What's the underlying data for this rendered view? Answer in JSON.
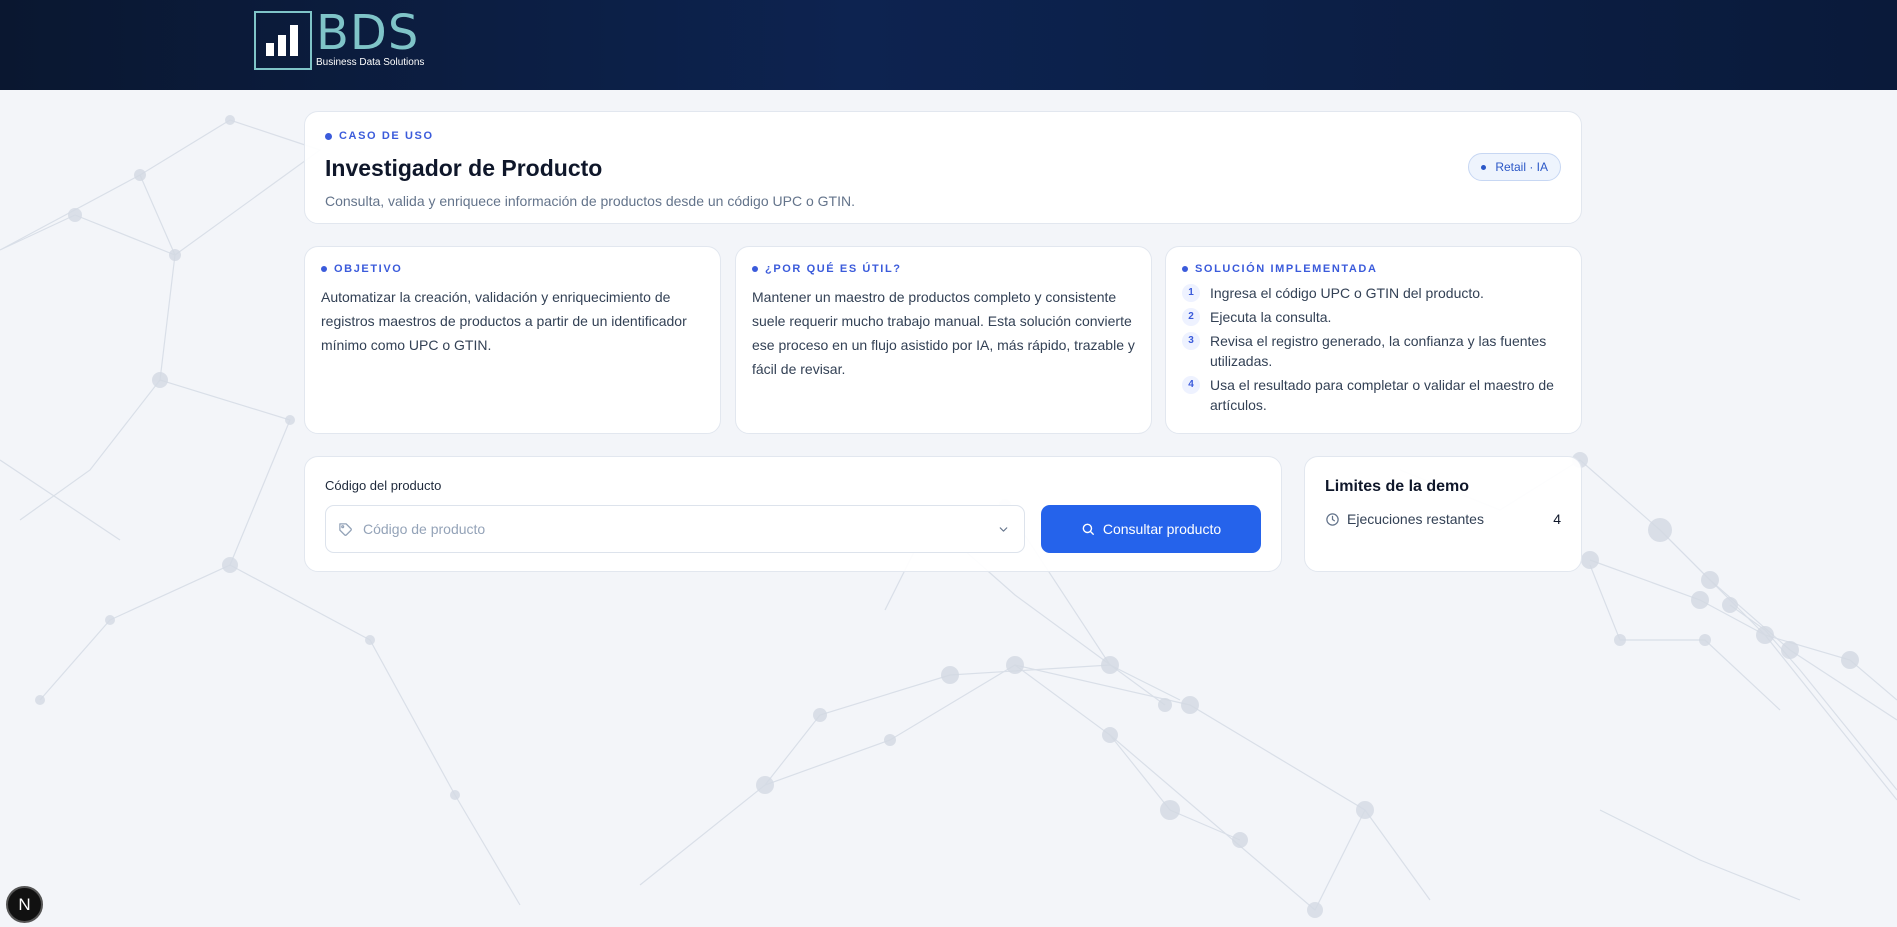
{
  "header": {
    "logo_letters": "BDS",
    "logo_sub": "Business Data Solutions"
  },
  "hero": {
    "eyebrow": "CASO DE USO",
    "title": "Investigador de Producto",
    "subtitle": "Consulta, valida y enriquece información de productos desde un código UPC o GTIN.",
    "pill": "Retail · IA"
  },
  "objective": {
    "eyebrow": "OBJETIVO",
    "text": "Automatizar la creación, validación y enriquecimiento de registros maestros de productos a partir de un identificador mínimo como UPC o GTIN."
  },
  "why": {
    "eyebrow": "¿POR QUÉ ES ÚTIL?",
    "text": "Mantener un maestro de productos completo y consistente suele requerir mucho trabajo manual. Esta solución convierte ese proceso en un flujo asistido por IA, más rápido, trazable y fácil de revisar."
  },
  "solution": {
    "eyebrow": "SOLUCIÓN IMPLEMENTADA",
    "steps": [
      {
        "num": "1",
        "text": "Ingresa el código UPC o GTIN del producto."
      },
      {
        "num": "2",
        "text": "Ejecuta la consulta."
      },
      {
        "num": "3",
        "text": "Revisa el registro generado, la confianza y las fuentes utilizadas."
      },
      {
        "num": "4",
        "text": "Usa el resultado para completar o validar el maestro de artículos."
      }
    ]
  },
  "query": {
    "label": "Código del producto",
    "placeholder": "Código de producto",
    "button": "Consultar producto"
  },
  "limits": {
    "title": "Limites de la demo",
    "row_label": "Ejecuciones restantes",
    "row_value": "4"
  },
  "badge": {
    "letter": "N"
  },
  "colors": {
    "accent": "#3b5bdb",
    "button": "#2563eb",
    "header": "#0d2350",
    "logo": "#7fc4c8"
  },
  "icons": {
    "input": "tag-icon",
    "dropdown": "chevron-down-icon",
    "button": "search-icon",
    "limits": "clock-icon"
  }
}
